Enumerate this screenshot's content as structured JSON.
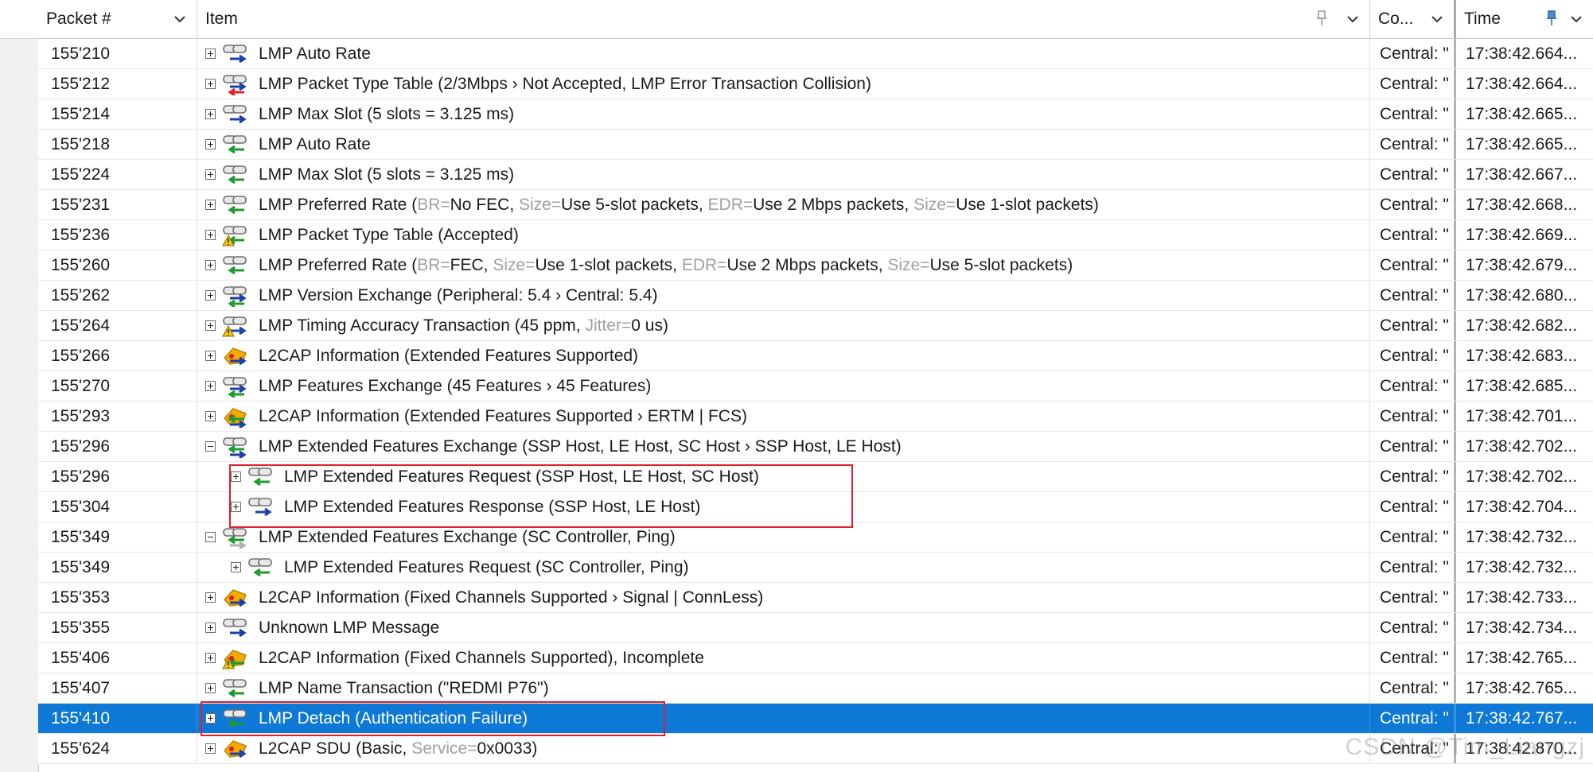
{
  "header": {
    "col_packet": "Packet #",
    "col_item": "Item",
    "col_conn": "Co...",
    "col_time": "Time"
  },
  "colors": {
    "selection": "#0d78d6",
    "highlight_box": "#e0202a",
    "arrow_blue": "#1c3fa8",
    "arrow_green": "#1f9a2f",
    "arrow_red": "#e0202a",
    "warn_yellow": "#f2c400",
    "l2cap_orange": "#f2a900"
  },
  "rows": [
    {
      "pkt": "155'210",
      "indent": 0,
      "exp": "plus",
      "icon": "lmp-link-icon",
      "dir": "tx",
      "segs": [
        {
          "t": "LMP Auto Rate"
        }
      ],
      "conn": "Central: \"",
      "time": "17:38:42.664..."
    },
    {
      "pkt": "155'212",
      "indent": 0,
      "exp": "plus",
      "icon": "lmp-link-icon",
      "dir": "tx-rx-error",
      "segs": [
        {
          "t": "LMP Packet Type Table (2/3Mbps › Not Accepted, LMP Error Transaction Collision)"
        }
      ],
      "conn": "Central: \"",
      "time": "17:38:42.664..."
    },
    {
      "pkt": "155'214",
      "indent": 0,
      "exp": "plus",
      "icon": "lmp-link-icon",
      "dir": "tx",
      "segs": [
        {
          "t": "LMP Max Slot (5 slots = 3.125 ms)"
        }
      ],
      "conn": "Central: \"",
      "time": "17:38:42.665..."
    },
    {
      "pkt": "155'218",
      "indent": 0,
      "exp": "plus",
      "icon": "lmp-link-icon",
      "dir": "rx",
      "segs": [
        {
          "t": "LMP Auto Rate"
        }
      ],
      "conn": "Central: \"",
      "time": "17:38:42.665..."
    },
    {
      "pkt": "155'224",
      "indent": 0,
      "exp": "plus",
      "icon": "lmp-link-icon",
      "dir": "rx",
      "segs": [
        {
          "t": "LMP Max Slot (5 slots = 3.125 ms)"
        }
      ],
      "conn": "Central: \"",
      "time": "17:38:42.667..."
    },
    {
      "pkt": "155'231",
      "indent": 0,
      "exp": "plus",
      "icon": "lmp-link-icon",
      "dir": "rx",
      "segs": [
        {
          "t": "LMP Preferred Rate ("
        },
        {
          "t": "BR=",
          "m": true
        },
        {
          "t": "No FEC, "
        },
        {
          "t": "Size=",
          "m": true
        },
        {
          "t": "Use 5-slot packets, "
        },
        {
          "t": "EDR=",
          "m": true
        },
        {
          "t": "Use 2 Mbps packets, "
        },
        {
          "t": "Size=",
          "m": true
        },
        {
          "t": "Use 1-slot packets)"
        }
      ],
      "conn": "Central: \"",
      "time": "17:38:42.668..."
    },
    {
      "pkt": "155'236",
      "indent": 0,
      "exp": "plus",
      "icon": "lmp-warning-icon",
      "dir": "rx-warn",
      "segs": [
        {
          "t": "LMP Packet Type Table (Accepted)"
        }
      ],
      "conn": "Central: \"",
      "time": "17:38:42.669..."
    },
    {
      "pkt": "155'260",
      "indent": 0,
      "exp": "plus",
      "icon": "lmp-link-icon",
      "dir": "rx",
      "segs": [
        {
          "t": "LMP Preferred Rate ("
        },
        {
          "t": "BR=",
          "m": true
        },
        {
          "t": "FEC, "
        },
        {
          "t": "Size=",
          "m": true
        },
        {
          "t": "Use 1-slot packets, "
        },
        {
          "t": "EDR=",
          "m": true
        },
        {
          "t": "Use 2 Mbps packets, "
        },
        {
          "t": "Size=",
          "m": true
        },
        {
          "t": "Use 5-slot packets)"
        }
      ],
      "conn": "Central: \"",
      "time": "17:38:42.679..."
    },
    {
      "pkt": "155'262",
      "indent": 0,
      "exp": "plus",
      "icon": "lmp-link-icon",
      "dir": "tx-rx",
      "segs": [
        {
          "t": "LMP Version Exchange (Peripheral: 5.4 › Central: 5.4)"
        }
      ],
      "conn": "Central: \"",
      "time": "17:38:42.680..."
    },
    {
      "pkt": "155'264",
      "indent": 0,
      "exp": "plus",
      "icon": "lmp-warning-icon",
      "dir": "tx-warn",
      "segs": [
        {
          "t": "LMP Timing Accuracy Transaction (45 ppm, "
        },
        {
          "t": "Jitter=",
          "m": true
        },
        {
          "t": "0 us)"
        }
      ],
      "conn": "Central: \"",
      "time": "17:38:42.682..."
    },
    {
      "pkt": "155'266",
      "indent": 0,
      "exp": "plus",
      "icon": "l2cap-icon",
      "dir": "tx",
      "segs": [
        {
          "t": "L2CAP Information (Extended Features Supported)"
        }
      ],
      "conn": "Central: \"",
      "time": "17:38:42.683..."
    },
    {
      "pkt": "155'270",
      "indent": 0,
      "exp": "plus",
      "icon": "lmp-link-icon",
      "dir": "tx-rx",
      "segs": [
        {
          "t": "LMP Features Exchange (45 Features › 45 Features)"
        }
      ],
      "conn": "Central: \"",
      "time": "17:38:42.685..."
    },
    {
      "pkt": "155'293",
      "indent": 0,
      "exp": "plus",
      "icon": "l2cap-icon",
      "dir": "rx-tx",
      "segs": [
        {
          "t": "L2CAP Information (Extended Features Supported › ERTM | FCS)"
        }
      ],
      "conn": "Central: \"",
      "time": "17:38:42.701..."
    },
    {
      "pkt": "155'296",
      "indent": 0,
      "exp": "minus",
      "icon": "lmp-link-icon",
      "dir": "rx-tx",
      "segs": [
        {
          "t": "LMP Extended Features Exchange (SSP Host, LE Host, SC Host › SSP Host, LE Host)"
        }
      ],
      "conn": "Central: \"",
      "time": "17:38:42.702..."
    },
    {
      "pkt": "155'296",
      "indent": 1,
      "exp": "plus",
      "icon": "lmp-link-icon",
      "dir": "rx",
      "segs": [
        {
          "t": "LMP Extended Features Request (SSP Host, LE Host, SC Host)"
        }
      ],
      "conn": "Central: \"",
      "time": "17:38:42.702..."
    },
    {
      "pkt": "155'304",
      "indent": 1,
      "exp": "plus",
      "icon": "lmp-link-icon",
      "dir": "tx",
      "segs": [
        {
          "t": "LMP Extended Features Response (SSP Host, LE Host)"
        }
      ],
      "conn": "Central: \"",
      "time": "17:38:42.704..."
    },
    {
      "pkt": "155'349",
      "indent": 0,
      "exp": "minus",
      "icon": "lmp-link-icon",
      "dir": "rx-faded",
      "segs": [
        {
          "t": "LMP Extended Features Exchange (SC Controller, Ping)"
        }
      ],
      "conn": "Central: \"",
      "time": "17:38:42.732..."
    },
    {
      "pkt": "155'349",
      "indent": 1,
      "exp": "plus",
      "icon": "lmp-link-icon",
      "dir": "rx",
      "segs": [
        {
          "t": "LMP Extended Features Request (SC Controller, Ping)"
        }
      ],
      "conn": "Central: \"",
      "time": "17:38:42.732..."
    },
    {
      "pkt": "155'353",
      "indent": 0,
      "exp": "plus",
      "icon": "l2cap-icon",
      "dir": "tx",
      "segs": [
        {
          "t": "L2CAP Information (Fixed Channels Supported › Signal | ConnLess)"
        }
      ],
      "conn": "Central: \"",
      "time": "17:38:42.733..."
    },
    {
      "pkt": "155'355",
      "indent": 0,
      "exp": "plus",
      "icon": "lmp-link-icon",
      "dir": "tx",
      "segs": [
        {
          "t": "Unknown LMP Message"
        }
      ],
      "conn": "Central: \"",
      "time": "17:38:42.734..."
    },
    {
      "pkt": "155'406",
      "indent": 0,
      "exp": "plus",
      "icon": "l2cap-warning-icon",
      "dir": "rx-warn",
      "segs": [
        {
          "t": "L2CAP Information (Fixed Channels Supported), Incomplete"
        }
      ],
      "conn": "Central: \"",
      "time": "17:38:42.765..."
    },
    {
      "pkt": "155'407",
      "indent": 0,
      "exp": "plus",
      "icon": "lmp-link-icon",
      "dir": "rx",
      "segs": [
        {
          "t": "LMP Name Transaction (\"REDMI P76\")"
        }
      ],
      "conn": "Central: \"",
      "time": "17:38:42.765..."
    },
    {
      "pkt": "155'410",
      "indent": 0,
      "exp": "plus",
      "icon": "lmp-link-icon",
      "dir": "rx",
      "selected": true,
      "segs": [
        {
          "t": "LMP Detach (Authentication Failure)"
        }
      ],
      "conn": "Central: \"",
      "time": "17:38:42.767..."
    },
    {
      "pkt": "155'624",
      "indent": 0,
      "exp": "plus",
      "icon": "l2cap-icon",
      "dir": "tx",
      "segs": [
        {
          "t": "L2CAP SDU (Basic, "
        },
        {
          "t": "Service=",
          "m": true
        },
        {
          "t": "0x0033)"
        }
      ],
      "conn": "Central: \"",
      "time": "17:38:42.870..."
    }
  ],
  "watermark": "CSDN @Tim_Liangzj"
}
